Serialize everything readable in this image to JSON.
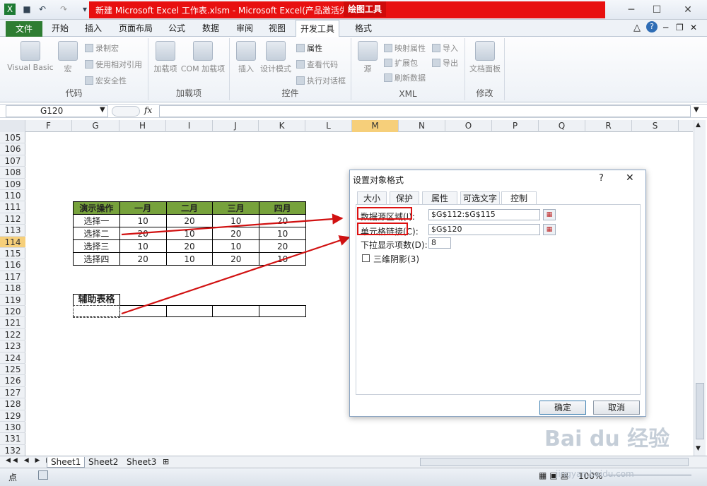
{
  "window": {
    "title": "新建 Microsoft Excel 工作表.xlsm - Microsoft Excel(产品激活失败)",
    "contextual_tab": "绘图工具"
  },
  "tabs": [
    "文件",
    "开始",
    "插入",
    "页面布局",
    "公式",
    "数据",
    "审阅",
    "视图",
    "开发工具",
    "格式"
  ],
  "ribbon": {
    "groups": [
      {
        "label": "代码",
        "buttons": [
          "Visual Basic",
          "宏"
        ],
        "small": [
          "录制宏",
          "使用相对引用",
          "宏安全性"
        ]
      },
      {
        "label": "加载项",
        "buttons": [
          "加载项",
          "COM 加载项"
        ]
      },
      {
        "label": "控件",
        "buttons": [
          "插入",
          "设计模式"
        ],
        "small": [
          "属性",
          "查看代码",
          "执行对话框"
        ]
      },
      {
        "label": "XML",
        "buttons": [
          "源"
        ],
        "small": [
          "映射属性",
          "导入",
          "扩展包",
          "导出",
          "刷新数据"
        ]
      },
      {
        "label": "修改",
        "buttons": [
          "文档面板"
        ]
      }
    ]
  },
  "formula_bar": {
    "name_box": "G120",
    "fx": "fx",
    "formula": ""
  },
  "columns": [
    "F",
    "G",
    "H",
    "I",
    "J",
    "K",
    "L",
    "M",
    "N",
    "O",
    "P",
    "Q",
    "R",
    "S"
  ],
  "selected_column": "M",
  "rows": [
    "105",
    "106",
    "107",
    "108",
    "109",
    "110",
    "111",
    "112",
    "113",
    "114",
    "115",
    "116",
    "117",
    "118",
    "119",
    "120",
    "121",
    "122",
    "123",
    "124",
    "125",
    "126",
    "127",
    "128",
    "129",
    "130",
    "131",
    "132"
  ],
  "selected_row": "114",
  "table": {
    "headers": [
      "演示操作",
      "一月",
      "二月",
      "三月",
      "四月"
    ],
    "rows": [
      [
        "选择一",
        "10",
        "20",
        "10",
        "20"
      ],
      [
        "选择二",
        "20",
        "10",
        "20",
        "10"
      ],
      [
        "选择三",
        "10",
        "20",
        "10",
        "20"
      ],
      [
        "选择四",
        "20",
        "10",
        "20",
        "10"
      ]
    ]
  },
  "helper_label": "辅助表格",
  "sheets": [
    "Sheet1",
    "Sheet2",
    "Sheet3"
  ],
  "status": {
    "mode": "点",
    "zoom": "100%"
  },
  "dialog": {
    "title": "设置对象格式",
    "help": "?",
    "close": "✕",
    "tabs": [
      "大小",
      "保护",
      "属性",
      "可选文字",
      "控制"
    ],
    "active_tab": "控制",
    "fields": {
      "input_range_label": "数据源区域(I):",
      "input_range_value": "$G$112:$G$115",
      "cell_link_label": "单元格链接(C):",
      "cell_link_value": "$G$120",
      "drop_lines_label": "下拉显示项数(D):",
      "drop_lines_value": "8",
      "shading_label": "三维阴影(3)"
    },
    "ok": "确定",
    "cancel": "取消"
  },
  "watermark": {
    "text": "Bai du 经验",
    "url": "jingyan.baidu.com"
  },
  "colors": {
    "accent_green": "#77a23c",
    "arrow_red": "#d11111",
    "title_red": "#e81010",
    "file_tab": "#2e7d32"
  }
}
